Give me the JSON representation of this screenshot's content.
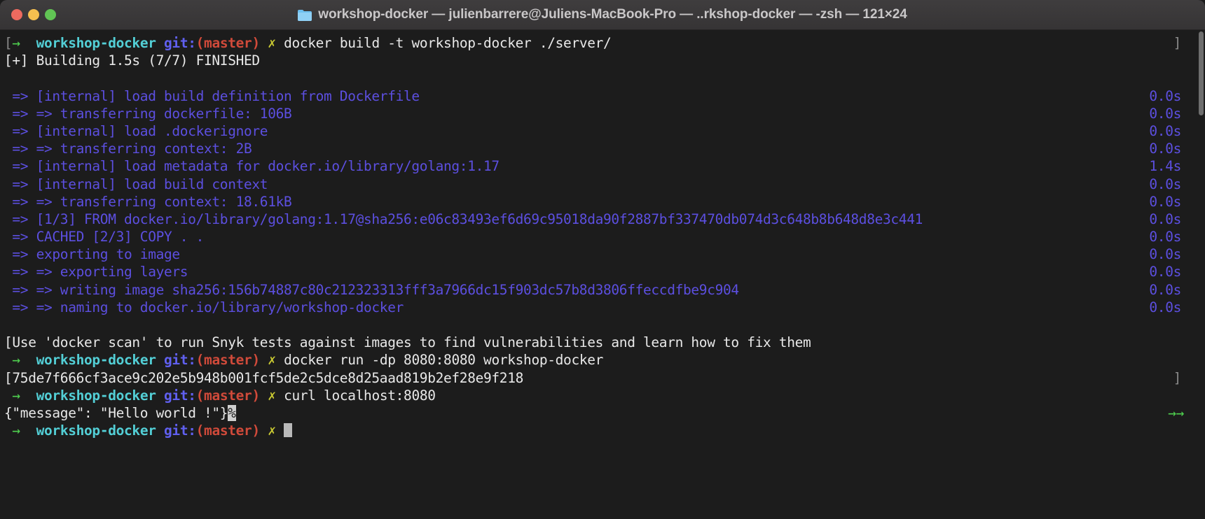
{
  "window": {
    "title": "workshop-docker — julienbarrere@Juliens-MacBook-Pro — ..rkshop-docker — -zsh — 121×24",
    "folder_icon": "folder-icon",
    "buttons": {
      "close": "close-window-button",
      "minimize": "minimize-window-button",
      "maximize": "maximize-window-button"
    },
    "colors": {
      "titlebar_bg": "#3b393a",
      "close": "#ed6a5f",
      "minimize": "#f5bf4f",
      "maximize": "#61c454",
      "terminal_bg": "#1c1c1c",
      "text": "#e8e8e8",
      "prompt_arrow": "#4fd14f",
      "prompt_dir": "#53cfd6",
      "prompt_git": "#6060f0",
      "prompt_branch": "#d04a3a",
      "prompt_status": "#c8c832",
      "build_output": "#5c4fe0"
    }
  },
  "prompt": {
    "arrow": "→",
    "dir": "workshop-docker",
    "git": "git:",
    "branch": "(master)",
    "status": "✗"
  },
  "terminal": {
    "commands": {
      "build": "docker build -t workshop-docker ./server/",
      "run": "docker run -dp 8080:8080 workshop-docker",
      "curl": "curl localhost:8080"
    },
    "build_header": "[+] Building 1.5s (7/7) FINISHED",
    "build_steps": [
      {
        "text": " => [internal] load build definition from Dockerfile",
        "time": "0.0s"
      },
      {
        "text": " => => transferring dockerfile: 106B",
        "time": "0.0s"
      },
      {
        "text": " => [internal] load .dockerignore",
        "time": "0.0s"
      },
      {
        "text": " => => transferring context: 2B",
        "time": "0.0s"
      },
      {
        "text": " => [internal] load metadata for docker.io/library/golang:1.17",
        "time": "1.4s"
      },
      {
        "text": " => [internal] load build context",
        "time": "0.0s"
      },
      {
        "text": " => => transferring context: 18.61kB",
        "time": "0.0s"
      },
      {
        "text": " => [1/3] FROM docker.io/library/golang:1.17@sha256:e06c83493ef6d69c95018da90f2887bf337470db074d3c648b8b648d8e3c441",
        "time": "0.0s"
      },
      {
        "text": " => CACHED [2/3] COPY . .",
        "time": "0.0s"
      },
      {
        "text": " => exporting to image",
        "time": "0.0s"
      },
      {
        "text": " => => exporting layers",
        "time": "0.0s"
      },
      {
        "text": " => => writing image sha256:156b74887c80c212323313fff3a7966dc15f903dc57b8d3806ffeccdfbe9c904",
        "time": "0.0s"
      },
      {
        "text": " => => naming to docker.io/library/workshop-docker",
        "time": "0.0s"
      }
    ],
    "scan_hint": "[Use 'docker scan' to run Snyk tests against images to find vulnerabilities and learn how to fix them",
    "container_id": "[75de7f666cf3ace9c202e5b948b001fcf5de2c5dce8d25aad819b2ef28e9f218",
    "curl_output": "{\"message\": \"Hello world !\"}",
    "curl_output_pct": "%",
    "edge_arrows": "→→",
    "edge_bracket_right": "]",
    "edge_bracket_left": "["
  }
}
